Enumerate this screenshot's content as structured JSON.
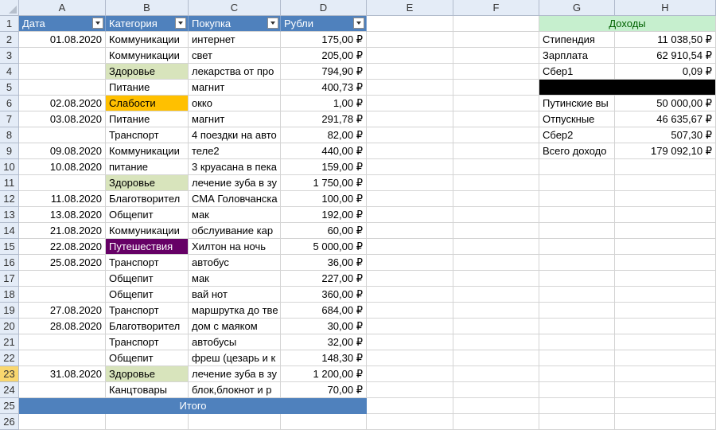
{
  "columns": [
    "A",
    "B",
    "C",
    "D",
    "E",
    "F",
    "G",
    "H"
  ],
  "table_headers": [
    "Дата",
    "Категория",
    "Покупка",
    "Рубли"
  ],
  "rows": [
    {
      "num": "2",
      "date": "01.08.2020",
      "cat": "Коммуникации",
      "item": "интернет",
      "rub": "175,00 ₽",
      "style": ""
    },
    {
      "num": "3",
      "date": "",
      "cat": "Коммуникации",
      "item": "свет",
      "rub": "205,00 ₽",
      "style": ""
    },
    {
      "num": "4",
      "date": "",
      "cat": "Здоровье",
      "item": "лекарства от про",
      "rub": "794,90 ₽",
      "style": "green"
    },
    {
      "num": "5",
      "date": "",
      "cat": "Питание",
      "item": "магнит",
      "rub": "400,73 ₽",
      "style": ""
    },
    {
      "num": "6",
      "date": "02.08.2020",
      "cat": "Слабости",
      "item": "окко",
      "rub": "1,00 ₽",
      "style": "orange"
    },
    {
      "num": "7",
      "date": "03.08.2020",
      "cat": "Питание",
      "item": "магнит",
      "rub": "291,78 ₽",
      "style": ""
    },
    {
      "num": "8",
      "date": "",
      "cat": "Транспорт",
      "item": "4 поездки на авто",
      "rub": "82,00 ₽",
      "style": ""
    },
    {
      "num": "9",
      "date": "09.08.2020",
      "cat": "Коммуникации",
      "item": "теле2",
      "rub": "440,00 ₽",
      "style": ""
    },
    {
      "num": "10",
      "date": "10.08.2020",
      "cat": "питание",
      "item": "3 круасана в пека",
      "rub": "159,00 ₽",
      "style": ""
    },
    {
      "num": "11",
      "date": "",
      "cat": "Здоровье",
      "item": "лечение зуба в зу",
      "rub": "1 750,00 ₽",
      "style": "green"
    },
    {
      "num": "12",
      "date": "11.08.2020",
      "cat": "Благотворител",
      "item": "СМА Головчанска",
      "rub": "100,00 ₽",
      "style": ""
    },
    {
      "num": "13",
      "date": "13.08.2020",
      "cat": "Общепит",
      "item": "мак",
      "rub": "192,00 ₽",
      "style": ""
    },
    {
      "num": "14",
      "date": "21.08.2020",
      "cat": "Коммуникации",
      "item": "обслуивание кар",
      "rub": "60,00 ₽",
      "style": ""
    },
    {
      "num": "15",
      "date": "22.08.2020",
      "cat": "Путешествия",
      "item": "Хилтон на ночь",
      "rub": "5 000,00 ₽",
      "style": "purple"
    },
    {
      "num": "16",
      "date": "25.08.2020",
      "cat": "Транспорт",
      "item": "автобус",
      "rub": "36,00 ₽",
      "style": ""
    },
    {
      "num": "17",
      "date": "",
      "cat": "Общепит",
      "item": "мак",
      "rub": "227,00 ₽",
      "style": ""
    },
    {
      "num": "18",
      "date": "",
      "cat": "Общепит",
      "item": "вай нот",
      "rub": "360,00 ₽",
      "style": ""
    },
    {
      "num": "19",
      "date": "27.08.2020",
      "cat": "Транспорт",
      "item": "маршрутка до тве",
      "rub": "684,00 ₽",
      "style": ""
    },
    {
      "num": "20",
      "date": "28.08.2020",
      "cat": "Благотворител",
      "item": "дом с маяком",
      "rub": "30,00 ₽",
      "style": ""
    },
    {
      "num": "21",
      "date": "",
      "cat": "Транспорт",
      "item": "автобусы",
      "rub": "32,00 ₽",
      "style": ""
    },
    {
      "num": "22",
      "date": "",
      "cat": "Общепит",
      "item": "фреш (цезарь и к",
      "rub": "148,30 ₽",
      "style": ""
    },
    {
      "num": "23",
      "date": "31.08.2020",
      "cat": "Здоровье",
      "item": "лечение зуба в зу",
      "rub": "1 200,00 ₽",
      "style": "green"
    },
    {
      "num": "24",
      "date": "",
      "cat": "Канцтовары",
      "item": "блок,блокнот и р",
      "rub": "70,00 ₽",
      "style": ""
    }
  ],
  "total_label": "Итого",
  "income": {
    "title": "Доходы",
    "items": [
      {
        "label": "Стипендия",
        "value": "11 038,50 ₽"
      },
      {
        "label": "Зарплата",
        "value": "62 910,54 ₽"
      },
      {
        "label": "Сбер1",
        "value": "0,09 ₽"
      },
      {
        "label": "",
        "value": ""
      },
      {
        "label": "Путинские вы",
        "value": "50 000,00 ₽"
      },
      {
        "label": "Отпускные",
        "value": "46 635,67 ₽"
      },
      {
        "label": "Сбер2",
        "value": "507,30 ₽"
      },
      {
        "label": "Всего доходо",
        "value": "179 092,10 ₽"
      }
    ]
  },
  "selected_row": "23",
  "colors": {
    "table_header": "#4f81bd",
    "green_fill": "#d8e4bc",
    "orange_fill": "#ffc000",
    "purple_fill": "#660066",
    "income_header": "#c6efce",
    "selected_row_header": "#f9d76f"
  }
}
